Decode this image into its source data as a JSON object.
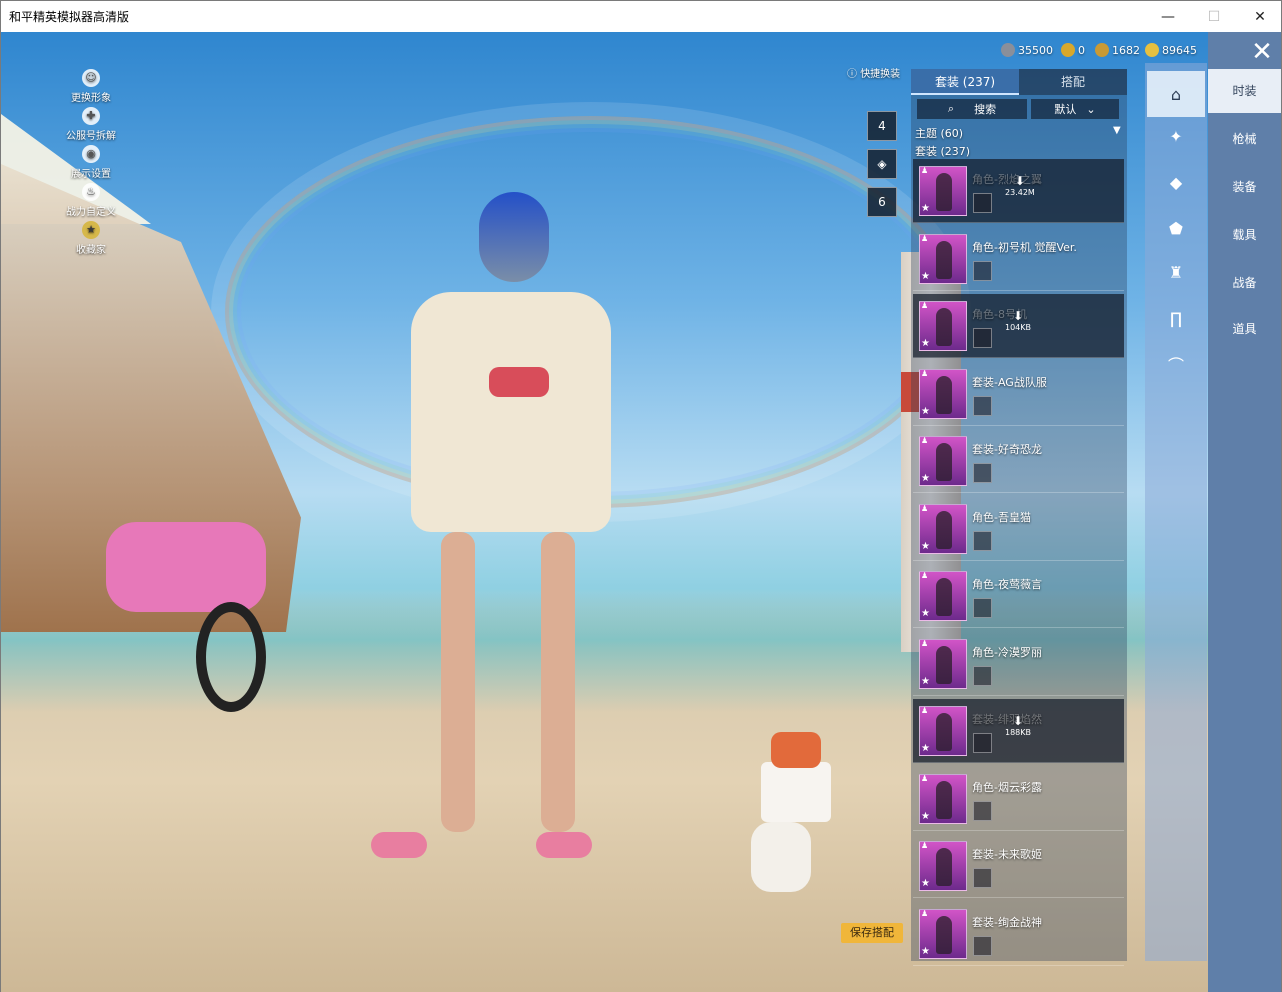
{
  "window": {
    "title": "和平精英模拟器高清版",
    "min_icon": "minimize-icon",
    "max_icon": "maximize-icon",
    "close_icon": "close-icon"
  },
  "left_menu": [
    {
      "label": "更换形象",
      "icon": "person-icon"
    },
    {
      "label": "公服号拆解",
      "icon": "gamepad-icon"
    },
    {
      "label": "展示设置",
      "icon": "eye-icon"
    },
    {
      "label": "战力自定义",
      "icon": "fire-icon"
    },
    {
      "label": "收藏家",
      "icon": "badge-icon"
    }
  ],
  "quick_change": {
    "label": "快捷换装",
    "help_icon": "help-icon",
    "slots": [
      "4",
      "",
      "6"
    ]
  },
  "currencies": [
    {
      "value": "35500",
      "color": "#8a8f9a"
    },
    {
      "value": "0",
      "color": "#d9a82b"
    },
    {
      "value": "1682",
      "color": "#c99a35"
    },
    {
      "value": "89645",
      "color": "#e6c040"
    }
  ],
  "panel": {
    "tabs": [
      {
        "label": "套装 (237)"
      },
      {
        "label": "搭配"
      }
    ],
    "search_label": "搜索",
    "sort_label": "默认",
    "sections": {
      "theme": "主题 (60)",
      "suits": "套装 (237)"
    },
    "items": [
      {
        "label": "角色-烈焰之翼",
        "dim": true,
        "download": "23.42M"
      },
      {
        "label": "角色-初号机 觉醒Ver.",
        "dim": false,
        "download": ""
      },
      {
        "label": "角色-8号机",
        "dim": true,
        "download": "104KB"
      },
      {
        "label": "套装-AG战队服",
        "dim": false,
        "download": ""
      },
      {
        "label": "套装-好奇恐龙",
        "dim": false,
        "download": ""
      },
      {
        "label": "角色-吾皇猫",
        "dim": false,
        "download": ""
      },
      {
        "label": "角色-夜莺薇言",
        "dim": false,
        "download": ""
      },
      {
        "label": "角色-冷漠罗丽",
        "dim": false,
        "download": ""
      },
      {
        "label": "套装-绯羽焰然",
        "dim": true,
        "download": "188KB"
      },
      {
        "label": "角色-烟云彩露",
        "dim": false,
        "download": ""
      },
      {
        "label": "套装-未来歌姬",
        "dim": false,
        "download": ""
      },
      {
        "label": "套装-绚金战神",
        "dim": false,
        "download": ""
      }
    ]
  },
  "categories": [
    "hat-icon",
    "gun-skin-icon",
    "bag-icon",
    "helmet-icon",
    "outfit-icon",
    "pants-icon",
    "shoes-icon"
  ],
  "nav": {
    "items": [
      "时装",
      "枪械",
      "装备",
      "载具",
      "战备",
      "道具"
    ]
  },
  "save_button": "保存搭配"
}
